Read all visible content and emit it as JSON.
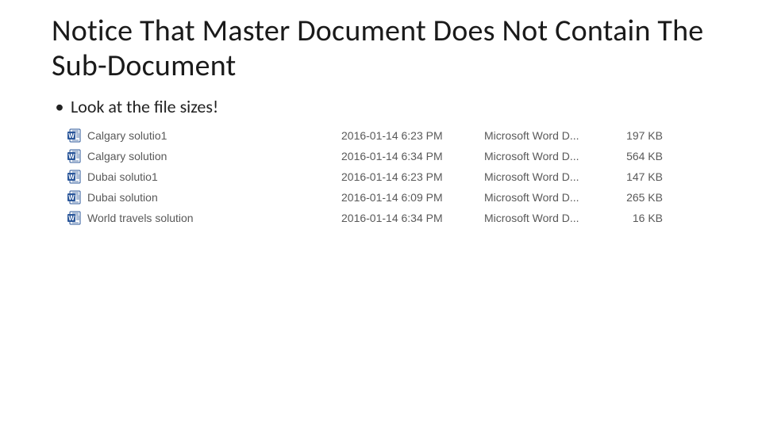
{
  "title": "Notice That Master Document Does Not Contain The Sub-Document",
  "bullet": "Look at the file sizes!",
  "files": [
    {
      "name": "Calgary solutio1",
      "date": "2016-01-14 6:23 PM",
      "type": "Microsoft Word D...",
      "size": "197 KB"
    },
    {
      "name": "Calgary solution",
      "date": "2016-01-14 6:34 PM",
      "type": "Microsoft Word D...",
      "size": "564 KB"
    },
    {
      "name": "Dubai solutio1",
      "date": "2016-01-14 6:23 PM",
      "type": "Microsoft Word D...",
      "size": "147 KB"
    },
    {
      "name": "Dubai solution",
      "date": "2016-01-14 6:09 PM",
      "type": "Microsoft Word D...",
      "size": "265 KB"
    },
    {
      "name": "World travels solution",
      "date": "2016-01-14 6:34 PM",
      "type": "Microsoft Word D...",
      "size": "16 KB"
    }
  ]
}
